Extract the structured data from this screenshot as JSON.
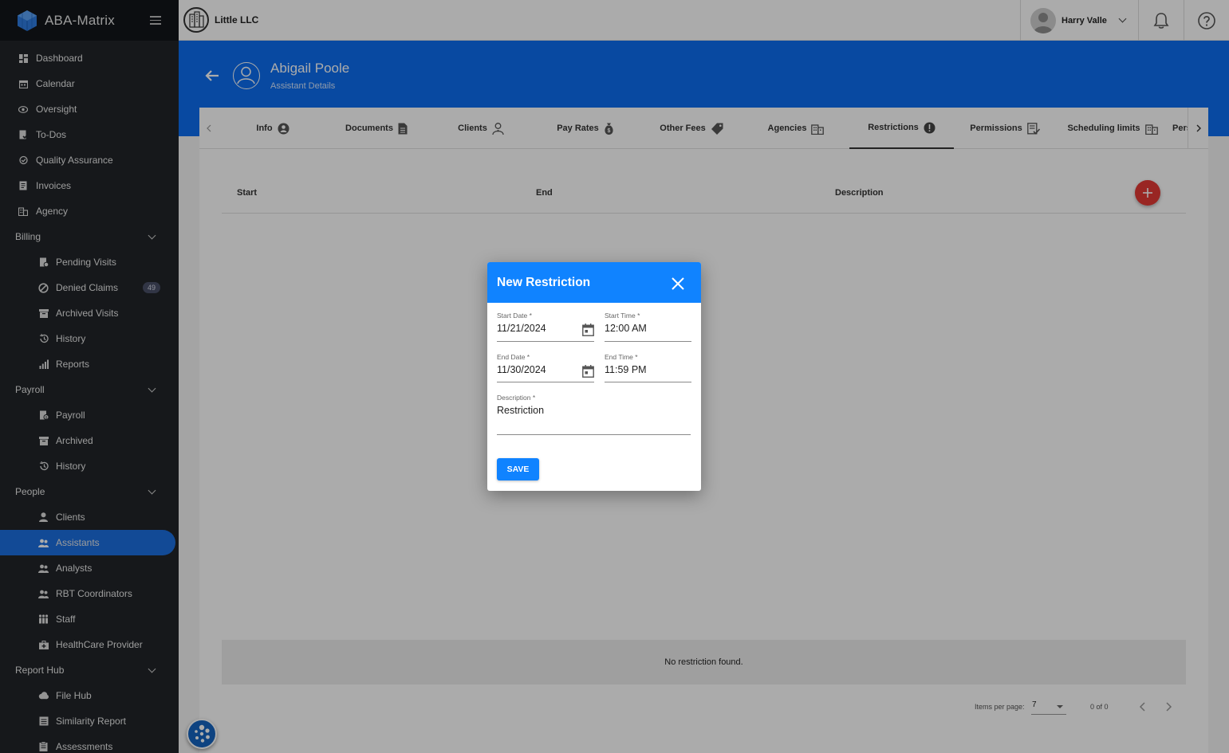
{
  "app": {
    "name": "ABA-Matrix"
  },
  "sidebar": {
    "items": [
      {
        "label": "Dashboard",
        "icon": "dashboard-icon"
      },
      {
        "label": "Calendar",
        "icon": "calendar-icon"
      },
      {
        "label": "Oversight",
        "icon": "eye-icon"
      },
      {
        "label": "To-Dos",
        "icon": "todo-icon"
      },
      {
        "label": "Quality Assurance",
        "icon": "qa-icon"
      },
      {
        "label": "Invoices",
        "icon": "invoice-icon"
      },
      {
        "label": "Agency",
        "icon": "building-icon"
      }
    ],
    "billing": {
      "label": "Billing",
      "items": [
        {
          "label": "Pending Visits",
          "icon": "pending-icon"
        },
        {
          "label": "Denied Claims",
          "icon": "denied-icon",
          "badge": "49"
        },
        {
          "label": "Archived Visits",
          "icon": "archive-icon"
        },
        {
          "label": "History",
          "icon": "history-icon"
        },
        {
          "label": "Reports",
          "icon": "reports-icon"
        }
      ]
    },
    "payroll": {
      "label": "Payroll",
      "items": [
        {
          "label": "Payroll",
          "icon": "payroll-icon"
        },
        {
          "label": "Archived",
          "icon": "archive-icon"
        },
        {
          "label": "History",
          "icon": "history-icon"
        }
      ]
    },
    "people": {
      "label": "People",
      "items": [
        {
          "label": "Clients",
          "icon": "person-icon"
        },
        {
          "label": "Assistants",
          "icon": "people-icon",
          "active": true
        },
        {
          "label": "Analysts",
          "icon": "people-icon"
        },
        {
          "label": "RBT Coordinators",
          "icon": "people-icon"
        },
        {
          "label": "Staff",
          "icon": "staff-icon"
        },
        {
          "label": "HealthCare Provider",
          "icon": "medical-bag-icon"
        }
      ]
    },
    "reporthub": {
      "label": "Report Hub",
      "items": [
        {
          "label": "File Hub",
          "icon": "cloud-icon"
        },
        {
          "label": "Similarity Report",
          "icon": "report-icon"
        },
        {
          "label": "Assessments",
          "icon": "assessment-icon"
        }
      ]
    }
  },
  "topbar": {
    "org_name": "Little LLC",
    "user_name": "Harry Valle"
  },
  "header": {
    "person_name": "Abigail Poole",
    "subtitle": "Assistant Details"
  },
  "tabs": [
    {
      "label": "Info"
    },
    {
      "label": "Documents"
    },
    {
      "label": "Clients"
    },
    {
      "label": "Pay Rates"
    },
    {
      "label": "Other Fees"
    },
    {
      "label": "Agencies"
    },
    {
      "label": "Restrictions",
      "active": true
    },
    {
      "label": "Permissions"
    },
    {
      "label": "Scheduling limits"
    },
    {
      "label": "Pers"
    }
  ],
  "table": {
    "columns": [
      "Start",
      "End",
      "Description"
    ],
    "empty_text": "No restriction found.",
    "items_per_page_label": "Items per page:",
    "items_per_page": "7",
    "range": "0 of 0"
  },
  "modal": {
    "title": "New Restriction",
    "start_date": {
      "label": "Start Date *",
      "value": "11/21/2024"
    },
    "start_time": {
      "label": "Start Time *",
      "value": "12:00 AM"
    },
    "end_date": {
      "label": "End Date *",
      "value": "11/30/2024"
    },
    "end_time": {
      "label": "End Time *",
      "value": "11:59 PM"
    },
    "description": {
      "label": "Description *",
      "value": "Restriction"
    },
    "save_label": "SAVE"
  },
  "colors": {
    "sidebar_bg": "#212529",
    "accent_blue": "#0c6ef0",
    "modal_blue": "#1083ff",
    "add_red": "#e53935"
  }
}
